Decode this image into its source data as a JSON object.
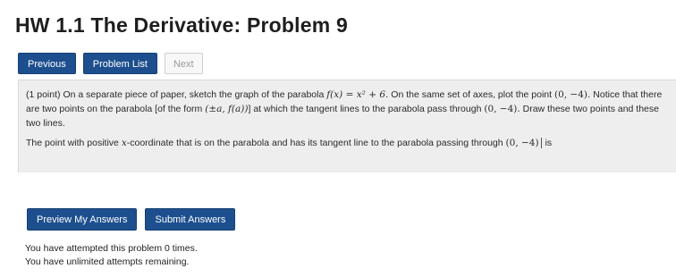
{
  "header": {
    "title": "HW 1.1 The Derivative: Problem 9"
  },
  "nav": {
    "previous_label": "Previous",
    "problem_list_label": "Problem List",
    "next_label": "Next"
  },
  "problem": {
    "points": "(1 point)",
    "text_1": "On a separate piece of paper, sketch the graph of the parabola",
    "function": "f(x) = x² + 6.",
    "text_2": "On the same set of axes, plot the point",
    "point": "(0, −4).",
    "text_3": "Notice that there are two points on the parabola [of the form",
    "form": "(±a, f(a))",
    "text_4": "] at which the tangent lines to the parabola pass through",
    "point_2": "(0, −4).",
    "text_5": "Draw these two points and these two lines.",
    "question_1": "The point with positive",
    "x_var": "x",
    "question_2": "-coordinate that is on the parabola and has its tangent line to the parabola passing through",
    "point_3": "(0, −4)",
    "question_3": "is"
  },
  "actions": {
    "preview_label": "Preview My Answers",
    "submit_label": "Submit Answers"
  },
  "status": {
    "attempts": "You have attempted this problem 0 times.",
    "remaining": "You have unlimited attempts remaining."
  },
  "colors": {
    "primary_button": "#1d4f8e",
    "problem_background": "#eeeeee"
  }
}
